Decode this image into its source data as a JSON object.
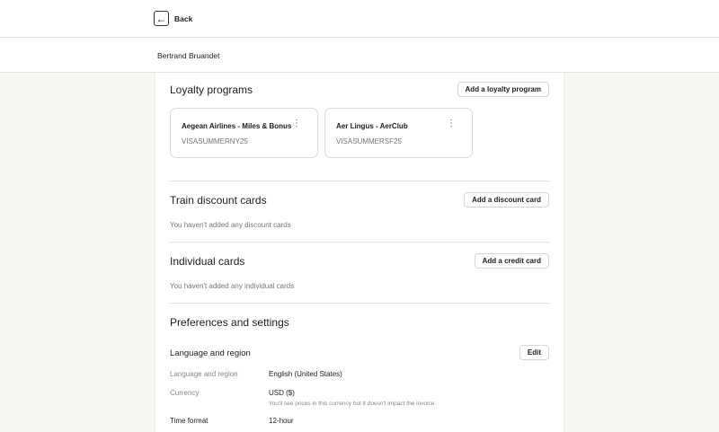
{
  "header": {
    "back_label": "Back",
    "user_name": "Bertrand Bruandet"
  },
  "loyalty": {
    "title": "Loyalty programs",
    "add_label": "Add a loyalty program",
    "cards": [
      {
        "name": "Aegean Airlines - Miles & Bonus",
        "code": "VISASUMMERNY25"
      },
      {
        "name": "Aer Lingus - AerClub",
        "code": "VISASUMMERSF25"
      }
    ]
  },
  "train": {
    "title": "Train discount cards",
    "add_label": "Add a discount card",
    "empty": "You haven't added any discount cards"
  },
  "individual": {
    "title": "Individual cards",
    "add_label": "Add a credit card",
    "empty": "You haven't added any individual cards"
  },
  "prefs": {
    "title": "Preferences and settings",
    "section": "Language and region",
    "edit_label": "Edit",
    "rows": [
      {
        "label": "Language and region",
        "value": "English (United States)"
      },
      {
        "label": "Currency",
        "value": "USD ($)",
        "note": "You'll see prices in this currency but it doesn't impact the invoice"
      },
      {
        "label": "Time format",
        "value": "12-hour"
      }
    ]
  }
}
